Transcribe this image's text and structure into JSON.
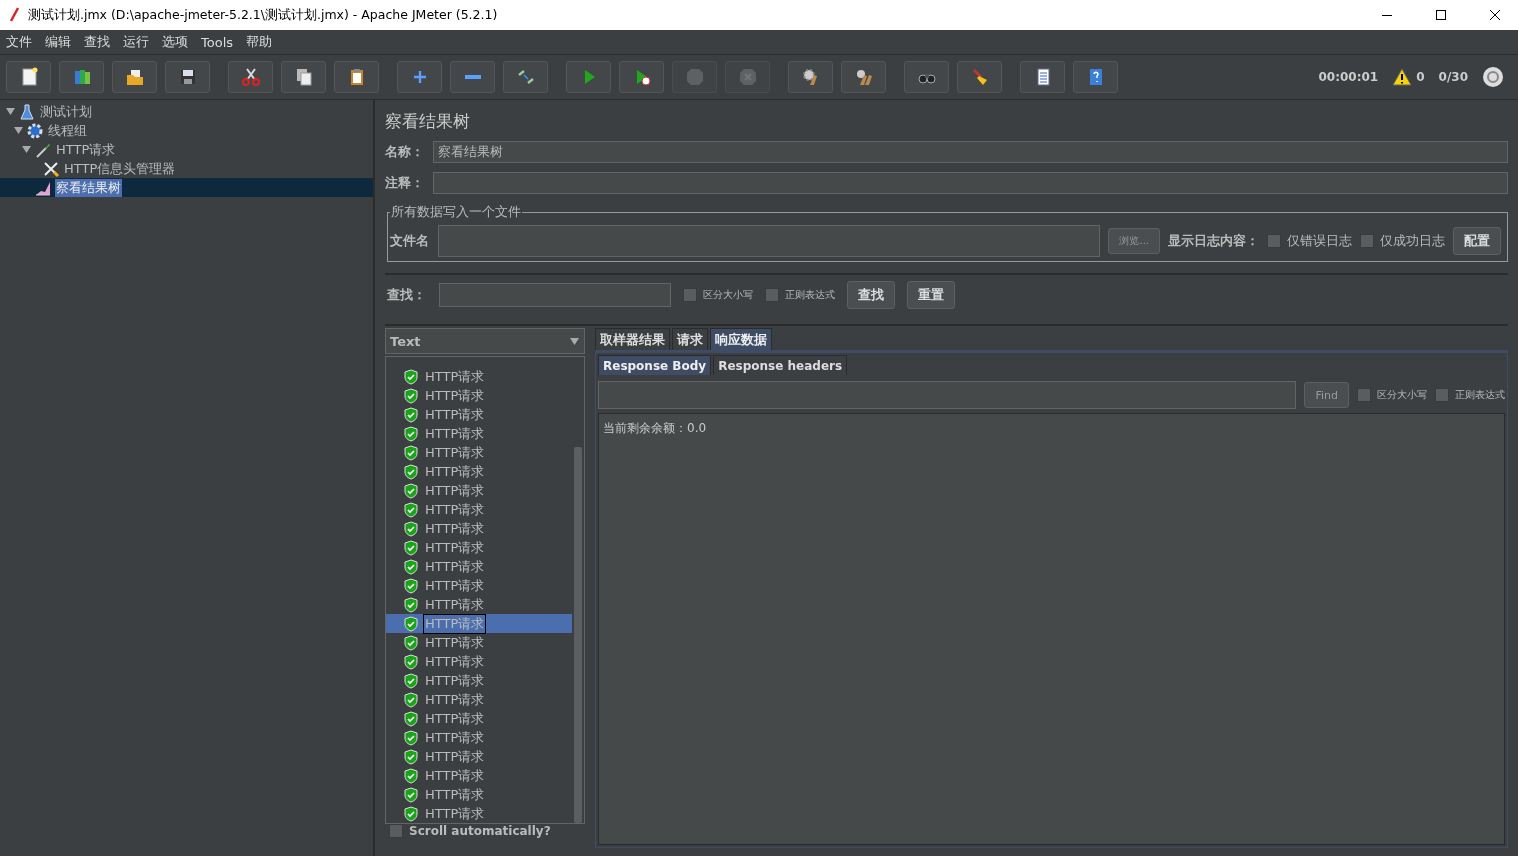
{
  "window": {
    "title": "测试计划.jmx (D:\\apache-jmeter-5.2.1\\测试计划.jmx) - Apache JMeter (5.2.1)"
  },
  "menu": [
    "文件",
    "编辑",
    "查找",
    "运行",
    "选项",
    "Tools",
    "帮助"
  ],
  "toolbar": {
    "groups": [
      {
        "buttons": [
          {
            "kind": "new",
            "disabled": false
          },
          {
            "kind": "templates",
            "disabled": false
          },
          {
            "kind": "open",
            "disabled": false
          },
          {
            "kind": "save",
            "disabled": false
          }
        ]
      },
      {
        "buttons": [
          {
            "kind": "cut",
            "disabled": false
          },
          {
            "kind": "copy",
            "disabled": false
          },
          {
            "kind": "paste",
            "disabled": false
          }
        ]
      },
      {
        "buttons": [
          {
            "kind": "expand",
            "disabled": false
          },
          {
            "kind": "collapse",
            "disabled": false
          },
          {
            "kind": "toggle",
            "disabled": false
          }
        ]
      },
      {
        "buttons": [
          {
            "kind": "start",
            "disabled": false
          },
          {
            "kind": "start_no_pause",
            "disabled": false
          },
          {
            "kind": "stop",
            "disabled": true
          },
          {
            "kind": "shutdown",
            "disabled": true
          }
        ]
      },
      {
        "buttons": [
          {
            "kind": "clear",
            "disabled": false
          },
          {
            "kind": "clear_all",
            "disabled": false
          }
        ]
      },
      {
        "buttons": [
          {
            "kind": "search",
            "disabled": false
          },
          {
            "kind": "reset_search",
            "disabled": false
          }
        ]
      },
      {
        "buttons": [
          {
            "kind": "functions",
            "disabled": false
          },
          {
            "kind": "help",
            "disabled": false
          }
        ]
      }
    ],
    "timer": "00:00:01",
    "warnings": "0",
    "threads": "0/30"
  },
  "tree": [
    {
      "label": "测试计划",
      "kind": "plan",
      "expanded": true,
      "selected": false,
      "children": [
        {
          "label": "线程组",
          "kind": "threadgroup",
          "expanded": true,
          "selected": false,
          "children": [
            {
              "label": "HTTP请求",
              "kind": "sampler",
              "expanded": true,
              "selected": false,
              "children": [
                {
                  "label": "HTTP信息头管理器",
                  "kind": "config",
                  "selected": false
                }
              ]
            },
            {
              "label": "察看结果树",
              "kind": "listener",
              "selected": true
            }
          ]
        }
      ]
    }
  ],
  "panel": {
    "title": "察看结果树",
    "name_label": "名称：",
    "name_value": "察看结果树",
    "comment_label": "注释：",
    "file_group": {
      "legend": "所有数据写入一个文件",
      "file_label": "文件名",
      "browse": "浏览...",
      "log_label": "显示日志内容：",
      "options": [
        {
          "label": "仅错误日志",
          "checked": false
        },
        {
          "label": "仅成功日志",
          "checked": false
        }
      ],
      "configure": "配置"
    },
    "search": {
      "label": "查找：",
      "options": [
        {
          "label": "区分大小写",
          "checked": false
        },
        {
          "label": "正则表达式",
          "checked": false
        }
      ],
      "find": "查找",
      "reset": "重置"
    },
    "renderer": "Text",
    "results": [
      {
        "label": "HTTP请求",
        "kind": "success",
        "selected": false
      },
      {
        "label": "HTTP请求",
        "kind": "success",
        "selected": false
      },
      {
        "label": "HTTP请求",
        "kind": "success",
        "selected": false
      },
      {
        "label": "HTTP请求",
        "kind": "success",
        "selected": false
      },
      {
        "label": "HTTP请求",
        "kind": "success",
        "selected": false
      },
      {
        "label": "HTTP请求",
        "kind": "success",
        "selected": false
      },
      {
        "label": "HTTP请求",
        "kind": "success",
        "selected": false
      },
      {
        "label": "HTTP请求",
        "kind": "success",
        "selected": false
      },
      {
        "label": "HTTP请求",
        "kind": "success",
        "selected": false
      },
      {
        "label": "HTTP请求",
        "kind": "success",
        "selected": false
      },
      {
        "label": "HTTP请求",
        "kind": "success",
        "selected": false
      },
      {
        "label": "HTTP请求",
        "kind": "success",
        "selected": false
      },
      {
        "label": "HTTP请求",
        "kind": "success",
        "selected": false
      },
      {
        "label": "HTTP请求",
        "kind": "success",
        "selected": true
      },
      {
        "label": "HTTP请求",
        "kind": "success",
        "selected": false
      },
      {
        "label": "HTTP请求",
        "kind": "success",
        "selected": false
      },
      {
        "label": "HTTP请求",
        "kind": "success",
        "selected": false
      },
      {
        "label": "HTTP请求",
        "kind": "success",
        "selected": false
      },
      {
        "label": "HTTP请求",
        "kind": "success",
        "selected": false
      },
      {
        "label": "HTTP请求",
        "kind": "success",
        "selected": false
      },
      {
        "label": "HTTP请求",
        "kind": "success",
        "selected": false
      },
      {
        "label": "HTTP请求",
        "kind": "success",
        "selected": false
      },
      {
        "label": "HTTP请求",
        "kind": "success",
        "selected": false
      },
      {
        "label": "HTTP请求",
        "kind": "success",
        "selected": false
      }
    ],
    "scroll_auto": {
      "label": "Scroll automatically?",
      "checked": false
    },
    "tabs": [
      {
        "label": "取样器结果",
        "selected": false
      },
      {
        "label": "请求",
        "selected": false
      },
      {
        "label": "响应数据",
        "selected": true
      }
    ],
    "subtabs": [
      {
        "label": "Response Body",
        "selected": true
      },
      {
        "label": "Response headers",
        "selected": false
      }
    ],
    "find": {
      "button": "Find",
      "options": [
        {
          "label": "区分大小写",
          "checked": false
        },
        {
          "label": "正则表达式",
          "checked": false
        }
      ]
    },
    "response_text": "当前剩余余额：0.0"
  }
}
